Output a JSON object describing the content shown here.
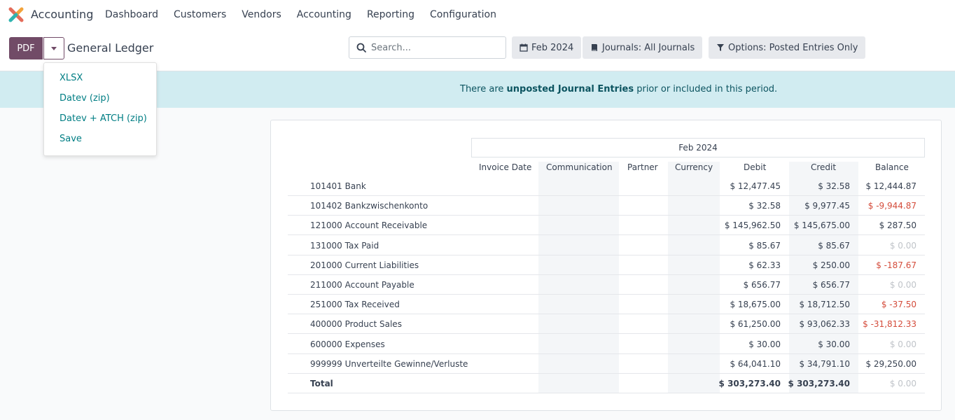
{
  "app": {
    "name": "Accounting"
  },
  "nav": [
    "Dashboard",
    "Customers",
    "Vendors",
    "Accounting",
    "Reporting",
    "Configuration"
  ],
  "control": {
    "pdf_label": "PDF",
    "title": "General Ledger",
    "search_placeholder": "Search...",
    "date_filter": "Feb 2024",
    "journals_filter": "Journals: All Journals",
    "options_filter": "Options: Posted Entries Only"
  },
  "export_menu": [
    "XLSX",
    "Datev (zip)",
    "Datev + ATCH (zip)",
    "Save"
  ],
  "banner": {
    "prefix": "There are ",
    "link": "unposted Journal Entries",
    "suffix": " prior or included in this period."
  },
  "report": {
    "period": "Feb 2024",
    "columns": [
      "Invoice Date",
      "Communication",
      "Partner",
      "Currency",
      "Debit",
      "Credit",
      "Balance"
    ],
    "rows": [
      {
        "name": "101401 Bank",
        "debit": "$ 12,477.45",
        "credit": "$ 32.58",
        "balance": "$ 12,444.87",
        "state": "pos"
      },
      {
        "name": "101402 Bankzwischenkonto",
        "debit": "$ 32.58",
        "credit": "$ 9,977.45",
        "balance": "$ -9,944.87",
        "state": "neg"
      },
      {
        "name": "121000 Account Receivable",
        "debit": "$ 145,962.50",
        "credit": "$ 145,675.00",
        "balance": "$ 287.50",
        "state": "pos"
      },
      {
        "name": "131000 Tax Paid",
        "debit": "$ 85.67",
        "credit": "$ 85.67",
        "balance": "$ 0.00",
        "state": "zero"
      },
      {
        "name": "201000 Current Liabilities",
        "debit": "$ 62.33",
        "credit": "$ 250.00",
        "balance": "$ -187.67",
        "state": "neg"
      },
      {
        "name": "211000 Account Payable",
        "debit": "$ 656.77",
        "credit": "$ 656.77",
        "balance": "$ 0.00",
        "state": "zero"
      },
      {
        "name": "251000 Tax Received",
        "debit": "$ 18,675.00",
        "credit": "$ 18,712.50",
        "balance": "$ -37.50",
        "state": "neg"
      },
      {
        "name": "400000 Product Sales",
        "debit": "$ 61,250.00",
        "credit": "$ 93,062.33",
        "balance": "$ -31,812.33",
        "state": "neg"
      },
      {
        "name": "600000 Expenses",
        "debit": "$ 30.00",
        "credit": "$ 30.00",
        "balance": "$ 0.00",
        "state": "zero"
      },
      {
        "name": "999999 Unverteilte Gewinne/Verluste",
        "debit": "$ 64,041.10",
        "credit": "$ 34,791.10",
        "balance": "$ 29,250.00",
        "state": "pos"
      }
    ],
    "total": {
      "name": "Total",
      "debit": "$ 303,273.40",
      "credit": "$ 303,273.40",
      "balance": "$ 0.00",
      "state": "zero"
    }
  }
}
